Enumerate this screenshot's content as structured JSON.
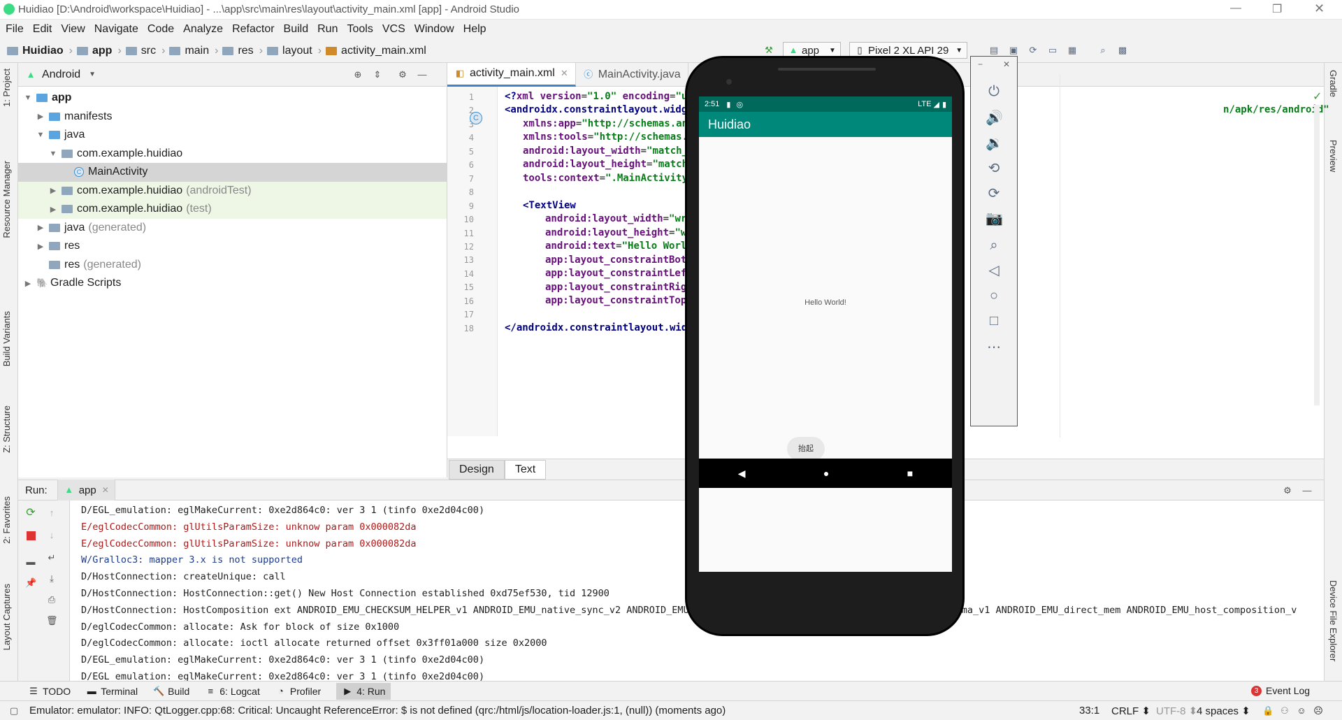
{
  "window": {
    "title": "Huidiao [D:\\Android\\workspace\\Huidiao] - ...\\app\\src\\main\\res\\layout\\activity_main.xml [app] - Android Studio"
  },
  "menu": [
    "File",
    "Edit",
    "View",
    "Navigate",
    "Code",
    "Analyze",
    "Refactor",
    "Build",
    "Run",
    "Tools",
    "VCS",
    "Window",
    "Help"
  ],
  "breadcrumb": [
    "Huidiao",
    "app",
    "src",
    "main",
    "res",
    "layout",
    "activity_main.xml"
  ],
  "toolbar": {
    "run_config": "app",
    "device": "Pixel 2 XL API 29"
  },
  "project": {
    "view": "Android",
    "tree": [
      {
        "label": "app",
        "extra": "",
        "depth": 0,
        "arrow": "▼",
        "bold": true
      },
      {
        "label": "manifests",
        "extra": "",
        "depth": 1,
        "arrow": "▶"
      },
      {
        "label": "java",
        "extra": "",
        "depth": 1,
        "arrow": "▼"
      },
      {
        "label": "com.example.huidiao",
        "extra": "",
        "depth": 2,
        "arrow": "▼"
      },
      {
        "label": "MainActivity",
        "extra": "",
        "depth": 3,
        "arrow": "",
        "selected": true
      },
      {
        "label": "com.example.huidiao",
        "extra": "(androidTest)",
        "depth": 2,
        "arrow": "▶",
        "green": true
      },
      {
        "label": "com.example.huidiao",
        "extra": "(test)",
        "depth": 2,
        "arrow": "▶",
        "green": true
      },
      {
        "label": "java",
        "extra": "(generated)",
        "depth": 1,
        "arrow": "▶"
      },
      {
        "label": "res",
        "extra": "",
        "depth": 1,
        "arrow": "▶"
      },
      {
        "label": "res",
        "extra": "(generated)",
        "depth": 1,
        "arrow": ""
      },
      {
        "label": "Gradle Scripts",
        "extra": "",
        "depth": 0,
        "arrow": "▶"
      }
    ]
  },
  "editor": {
    "tabs": [
      "activity_main.xml",
      "MainActivity.java"
    ],
    "lines": [
      "1",
      "2",
      "3",
      "4",
      "5",
      "6",
      "7",
      "8",
      "9",
      "10",
      "11",
      "12",
      "13",
      "14",
      "15",
      "16",
      "17",
      "18"
    ],
    "code": {
      "l1a": "<?",
      "l1b": "xml version",
      "l1c": "=",
      "l1d": "\"1.0\"",
      "l1e": " encoding",
      "l1f": "=",
      "l1g": "\"ut",
      "l2a": "<androidx.constraintlayout.widge",
      "l2tail": "n/apk/res/android\"",
      "l3a": "xmlns:app",
      "l3b": "=",
      "l3c": "\"http://schemas.an",
      "l4a": "xmlns:tools",
      "l4b": "=",
      "l4c": "\"http://schemas.",
      "l5a": "android:layout_width",
      "l5b": "=",
      "l5c": "\"match_",
      "l6a": "android:layout_height",
      "l6b": "=",
      "l6c": "\"match",
      "l7a": "tools:context",
      "l7b": "=",
      "l7c": "\".MainActivity",
      "l9a": "<TextView",
      "l10a": "android:layout_width",
      "l10b": "=",
      "l10c": "\"wr",
      "l11a": "android:layout_height",
      "l11b": "=",
      "l11c": "\"w",
      "l12a": "android:text",
      "l12b": "=",
      "l12c": "\"Hello Worl",
      "l13a": "app:layout_constraintBot",
      "l14a": "app:layout_constraintLef",
      "l15a": "app:layout_constraintRig",
      "l16a": "app:layout_constraintTop",
      "l18a": "</androidx.constraintlayout.widg"
    },
    "bottom_tabs": [
      "Design",
      "Text"
    ]
  },
  "run": {
    "label": "Run:",
    "config": "app",
    "lines": [
      {
        "t": "D/EGL_emulation: eglMakeCurrent: 0xe2d864c0: ver 3 1 (tinfo 0xe2d04c00)",
        "k": "d"
      },
      {
        "t": "E/eglCodecCommon: glUtilsParamSize: unknow param 0x000082da",
        "k": "e"
      },
      {
        "t": "E/eglCodecCommon: glUtilsParamSize: unknow param 0x000082da",
        "k": "e"
      },
      {
        "t": "W/Gralloc3: mapper 3.x is not supported",
        "k": "w"
      },
      {
        "t": "D/HostConnection: createUnique: call",
        "k": "d"
      },
      {
        "t": "D/HostConnection: HostConnection::get() New Host Connection established 0xd75ef530, tid 12900",
        "k": "d"
      },
      {
        "t": "D/HostConnection: HostComposition ext ANDROID_EMU_CHECKSUM_HELPER_v1 ANDROID_EMU_native_sync_v2 ANDROID_EMU                                          _EMU_dma_v1 ANDROID_EMU_direct_mem ANDROID_EMU_host_composition_v",
        "k": "d"
      },
      {
        "t": "D/eglCodecCommon: allocate: Ask for block of size 0x1000",
        "k": "d"
      },
      {
        "t": "D/eglCodecCommon: allocate: ioctl allocate returned offset 0x3ff01a000 size 0x2000",
        "k": "d"
      },
      {
        "t": "D/EGL_emulation: eglMakeCurrent: 0xe2d864c0: ver 3 1 (tinfo 0xe2d04c00)",
        "k": "d"
      },
      {
        "t": "D/EGL_emulation: eglMakeCurrent: 0xe2d864c0: ver 3 1 (tinfo 0xe2d04c00)",
        "k": "d"
      }
    ]
  },
  "left_tabs": [
    "1: Project",
    "Resource Manager",
    "Build Variants",
    "Z: Structure",
    "2: Favorites",
    "Layout Captures"
  ],
  "right_tabs": [
    "Gradle",
    "Preview",
    "Device File Explorer"
  ],
  "bottom_tabs": [
    {
      "label": "TODO",
      "icon": "☰"
    },
    {
      "label": "Terminal",
      "icon": "▬"
    },
    {
      "label": "Build",
      "icon": "🔨"
    },
    {
      "label": "6: Logcat",
      "icon": "≡"
    },
    {
      "label": "Profiler",
      "icon": "◔"
    },
    {
      "label": "4: Run",
      "icon": "▶",
      "active": true
    }
  ],
  "event_log": {
    "count": "3",
    "label": "Event Log"
  },
  "status": {
    "message": "Emulator: emulator: INFO: QtLogger.cpp:68: Critical: Uncaught ReferenceError: $ is not defined (qrc:/html/js/location-loader.js:1, (null)) (moments ago)",
    "position": "33:1",
    "line_sep": "CRLF ⬍",
    "encoding": "UTF-8 ⬍",
    "indent": "4 spaces ⬍"
  },
  "device": {
    "time": "2:51",
    "network": "LTE",
    "app_title": "Huidiao",
    "hello": "Hello World!",
    "button": "抬起"
  }
}
